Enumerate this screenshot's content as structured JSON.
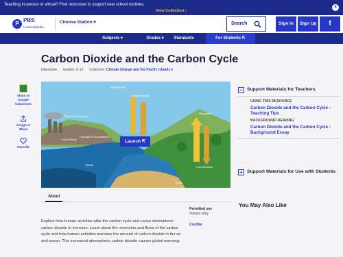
{
  "banner": {
    "message": "Teaching in-person or virtual? Find resources to support new school routines.",
    "link": "View Collection ›",
    "close": "×"
  },
  "header": {
    "logo_letter": "P",
    "logo_name": "PBS",
    "logo_sub": "LearningMedia",
    "station": "Choose Station ▾",
    "search": "Search",
    "sign_in": "Sign In",
    "sign_up": "Sign Up",
    "facebook": "f"
  },
  "nav": {
    "subjects": "Subjects ▾",
    "grades": "Grades ▾",
    "standards": "Standards",
    "students": "For Students ⇱"
  },
  "page": {
    "title": "Carbon Dioxide and the Carbon Cycle",
    "type": "Interactive",
    "grades": "Grades: 6-12",
    "collection_label": "Collection:",
    "collection": "Climate Change and the Pacific Islands ▾"
  },
  "tools": {
    "share_gc": "Share to Google Classroom",
    "assign": "Assign or Share",
    "favorite": "Favorite"
  },
  "interactive": {
    "launch": "Launch ⇱",
    "atmosphere": "Atmosphere",
    "photosynthesis": "Photosynthesis",
    "respiration": "Respiration",
    "fossil_fuels": "Fossil fuel emissions",
    "changes": "Changes to Ecosystems",
    "fossil_plants": "Fossil Plants",
    "ocean": "Ocean",
    "land": "Land Biomass",
    "rocks": "Rocks"
  },
  "about": {
    "tab": "About",
    "description": "Explore how human activities alter the carbon cycle and cause atmospheric carbon dioxide to increase. Learn about the reservoirs and flows of the carbon cycle and how human activities increase the amount of carbon dioxide in the air and ocean. This increased atmospheric carbon dioxide causes global warming.",
    "permitted_label": "Permitted use",
    "permitted": "Stream Only",
    "credits": "Credits"
  },
  "right": {
    "teachers_head": "Support Materials for Teachers",
    "using_label": "USING THIS RESOURCE",
    "using_link": "Carbon Dioxide and the Carbon Cycle - Teaching Tips",
    "bg_label": "BACKGROUND READING",
    "bg_link": "Carbon Dioxide and the Carbon Cycle - Background Essay",
    "students_head": "Support Materials for Use with Students",
    "may_also": "You May Also Like"
  }
}
